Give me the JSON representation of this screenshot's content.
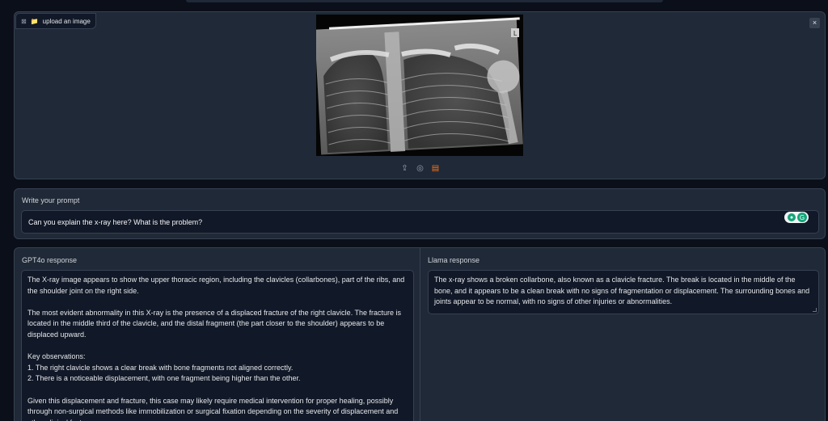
{
  "upload": {
    "label": "upload an image",
    "image_icon": "image-icon",
    "folder_icon": "folder-icon",
    "close_label": "×",
    "xray_marker": "L"
  },
  "image_toolbar": {
    "icons": [
      "upload-icon",
      "webcam-icon",
      "clipboard-icon"
    ]
  },
  "prompt": {
    "label": "Write your prompt",
    "value": "Can you explain the x-ray here? What is the problem?"
  },
  "gpt": {
    "label": "GPT4o response",
    "paragraphs": [
      "The X-ray image appears to show the upper thoracic region, including the clavicles (collarbones), part of the ribs, and the shoulder joint on the right side.",
      "The most evident abnormality in this X-ray is the presence of a displaced fracture of the right clavicle. The fracture is located in the middle third of the clavicle, and the distal fragment (the part closer to the shoulder) appears to be displaced upward.",
      "Key observations:\n1. The right clavicle shows a clear break with bone fragments not aligned correctly.\n2. There is a noticeable displacement, with one fragment being higher than the other.",
      "Given this displacement and fracture, this case may likely require medical intervention for proper healing, possibly through non-surgical methods like immobilization or surgical fixation depending on the severity of displacement and other clinical factors."
    ]
  },
  "llama": {
    "label": "Llama response",
    "text": "The x-ray shows a broken collarbone, also known as a clavicle fracture. The break is located in the middle of the bone, and it appears to be a clean break with no signs of fragmentation or displacement. The surrounding bones and joints appear to be normal, with no signs of other injuries or abnormalities."
  },
  "colors": {
    "background": "#0b0f19",
    "panel": "#1f2937",
    "border": "#374151",
    "input": "#111827",
    "accent": "#f97316",
    "grammar_green": "#15a57a"
  }
}
